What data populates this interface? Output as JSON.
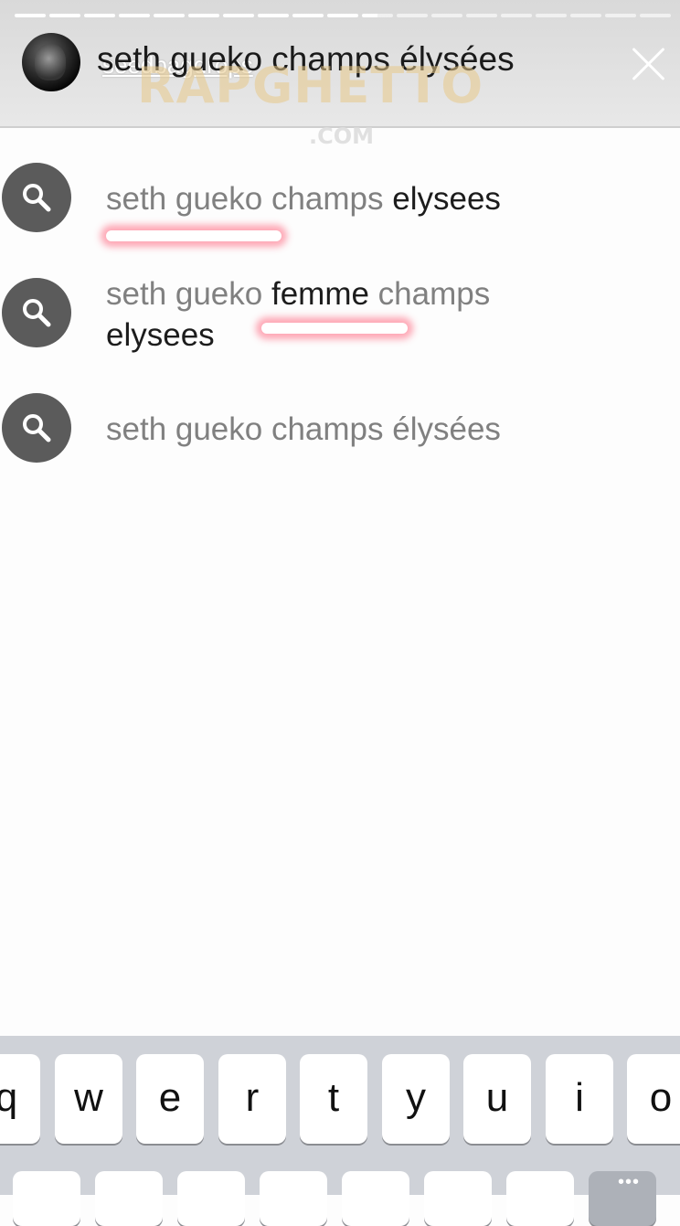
{
  "header": {
    "progress_total": 19,
    "progress_completed": 10.5,
    "username": "seedbagdrops",
    "query": "seth gueko champs élysées",
    "close_label": "×"
  },
  "watermark": {
    "brand": "RAPGHETTO",
    "domain": ".COM"
  },
  "suggestions": [
    {
      "dim": "seth gueko champs ",
      "bold": "elysees",
      "rest": ""
    },
    {
      "dim": "seth gueko ",
      "bold": "femme",
      "rest": " champs ",
      "bold2": "elysees"
    },
    {
      "dim": "seth gueko champs élysées",
      "bold": "",
      "rest": ""
    }
  ],
  "keyboard": {
    "row1": [
      "q",
      "w",
      "e",
      "r",
      "t",
      "y",
      "u",
      "i",
      "o"
    ],
    "row2_partial": [
      "",
      "",
      "",
      "",
      "",
      "",
      "",
      "",
      ""
    ],
    "more_indicator": "•••"
  },
  "colors": {
    "header_bg": "#dddddd",
    "icon_bg": "#5b5b5b",
    "highlight_glow": "#ff3c5a",
    "keyboard_bg": "#cfd2d8"
  }
}
